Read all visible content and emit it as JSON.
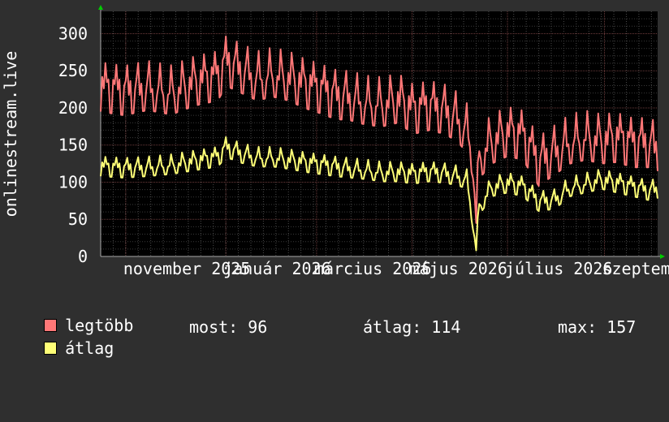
{
  "colors": {
    "background": "#2f2f2f",
    "canvas": "#000000",
    "grid": "#4a4a4a",
    "axis": "#aaaaaa",
    "arrow": "#00cc00",
    "series_max": "#ff7777",
    "series_avg": "#ffff77"
  },
  "chart_data": {
    "type": "line",
    "ylabel": "onlinestream.live",
    "ylim": [
      0,
      330
    ],
    "yticks": [
      0,
      50,
      100,
      150,
      200,
      250,
      300
    ],
    "xlim": [
      0,
      356
    ],
    "xticks": [
      {
        "pos": 16,
        "label": "november 2025"
      },
      {
        "pos": 80,
        "label": "január 2026"
      },
      {
        "pos": 138,
        "label": "március 2026"
      },
      {
        "pos": 199,
        "label": "május 2026"
      },
      {
        "pos": 260,
        "label": "július 2026"
      },
      {
        "pos": 322,
        "label": "szeptember"
      }
    ],
    "grid": true,
    "legend_position": "bottom-left",
    "series": [
      {
        "name": "legtöbb",
        "color": "#ff7777",
        "anchors": [
          [
            0,
            230
          ],
          [
            15,
            225
          ],
          [
            30,
            232
          ],
          [
            45,
            226
          ],
          [
            60,
            238
          ],
          [
            75,
            245
          ],
          [
            80,
            265
          ],
          [
            90,
            255
          ],
          [
            100,
            245
          ],
          [
            110,
            250
          ],
          [
            120,
            245
          ],
          [
            130,
            235
          ],
          [
            140,
            228
          ],
          [
            150,
            220
          ],
          [
            160,
            218
          ],
          [
            170,
            212
          ],
          [
            180,
            210
          ],
          [
            190,
            215
          ],
          [
            200,
            200
          ],
          [
            210,
            205
          ],
          [
            220,
            200
          ],
          [
            228,
            190
          ],
          [
            234,
            175
          ],
          [
            238,
            140
          ],
          [
            240,
            50
          ],
          [
            242,
            140
          ],
          [
            250,
            160
          ],
          [
            260,
            170
          ],
          [
            270,
            165
          ],
          [
            280,
            130
          ],
          [
            290,
            145
          ],
          [
            300,
            160
          ],
          [
            310,
            165
          ],
          [
            320,
            160
          ],
          [
            330,
            162
          ],
          [
            340,
            155
          ],
          [
            350,
            155
          ],
          [
            356,
            150
          ]
        ]
      },
      {
        "name": "átlag",
        "color": "#ffff77",
        "anchors": [
          [
            0,
            122
          ],
          [
            15,
            120
          ],
          [
            30,
            122
          ],
          [
            45,
            125
          ],
          [
            60,
            130
          ],
          [
            75,
            135
          ],
          [
            80,
            148
          ],
          [
            90,
            140
          ],
          [
            100,
            135
          ],
          [
            110,
            135
          ],
          [
            120,
            132
          ],
          [
            130,
            128
          ],
          [
            140,
            125
          ],
          [
            150,
            122
          ],
          [
            160,
            120
          ],
          [
            170,
            118
          ],
          [
            180,
            115
          ],
          [
            190,
            115
          ],
          [
            200,
            112
          ],
          [
            210,
            115
          ],
          [
            220,
            113
          ],
          [
            228,
            110
          ],
          [
            234,
            105
          ],
          [
            238,
            50
          ],
          [
            240,
            10
          ],
          [
            242,
            70
          ],
          [
            250,
            95
          ],
          [
            260,
            100
          ],
          [
            270,
            95
          ],
          [
            280,
            75
          ],
          [
            290,
            78
          ],
          [
            300,
            95
          ],
          [
            310,
            100
          ],
          [
            320,
            105
          ],
          [
            330,
            100
          ],
          [
            340,
            95
          ],
          [
            350,
            90
          ],
          [
            356,
            92
          ]
        ]
      }
    ]
  },
  "legend": {
    "max_label": "legtöbb",
    "avg_label": "átlag",
    "now_text": "most: 96",
    "avg_text": "átlag: 114",
    "max_text": "max: 157"
  }
}
